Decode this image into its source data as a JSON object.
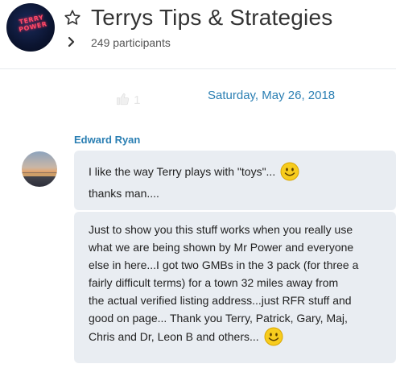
{
  "header": {
    "group_title": "Terrys Tips & Strategies",
    "participants": "249 participants",
    "avatar_text": "TERRY POWER"
  },
  "conversation": {
    "like_count": "1",
    "date_separator": "Saturday, May 26, 2018",
    "sender": "Edward Ryan",
    "messages": [
      {
        "lines": [
          "I like the way Terry plays with \"toys\"...",
          "thanks man...."
        ],
        "emoji": "smiley-emoji"
      },
      {
        "lines": [
          "Just to show you this stuff works when you really use",
          "what we are being shown by Mr Power and everyone",
          "else in here...I got two GMBs in the 3 pack (for three a",
          "fairly difficult terms) for a town 32 miles away from",
          "the actual verified listing address...just RFR stuff and",
          "good on page... Thank you Terry, Patrick, Gary, Maj,",
          "Chris and Dr, Leon B and others..."
        ],
        "emoji": "smiley-emoji"
      }
    ]
  },
  "colors": {
    "accent": "#2b7fb3",
    "bubble": "#e9edf2",
    "emoji": "#f5c518"
  }
}
